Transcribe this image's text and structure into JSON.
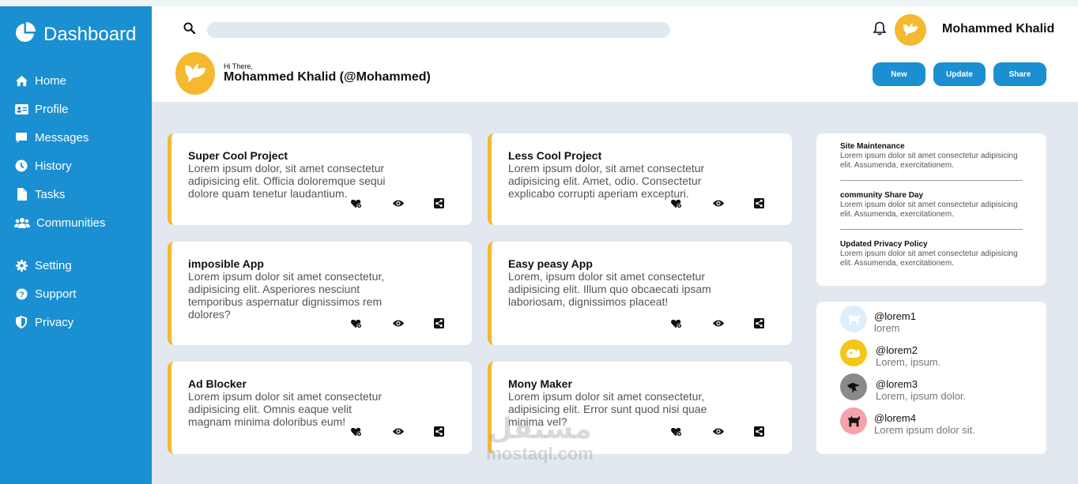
{
  "sidebar": {
    "brand": "Dashboard",
    "items": [
      {
        "label": "Home",
        "icon": "home-icon"
      },
      {
        "label": "Profile",
        "icon": "id-card-icon"
      },
      {
        "label": "Messages",
        "icon": "message-icon"
      },
      {
        "label": "History",
        "icon": "clock-icon"
      },
      {
        "label": "Tasks",
        "icon": "file-icon"
      },
      {
        "label": "Communities",
        "icon": "users-icon"
      },
      {
        "label": "Setting",
        "icon": "gear-icon"
      },
      {
        "label": "Support",
        "icon": "question-icon"
      },
      {
        "label": "Privacy",
        "icon": "shield-icon"
      }
    ]
  },
  "header": {
    "search": {
      "placeholder": "",
      "value": ""
    },
    "user_name": "Mohammed Khalid",
    "greeting_small": "Hi There,",
    "greeting_name": "Mohammed Khalid (@Mohammed)",
    "buttons": {
      "new": "New",
      "update": "Update",
      "share": "Share"
    }
  },
  "projects": [
    {
      "title": "Super Cool Project",
      "description": "Lorem ipsum dolor, sit amet consectetur adipisicing elit. Officia doloremque sequi dolore quam tenetur laudantium."
    },
    {
      "title": "Less Cool Project",
      "description": "Lorem ipsum dolor, sit amet consectetur adipisicing elit. Amet, odio. Consectetur explicabo corrupti aperiam excepturi."
    },
    {
      "title": "imposible App",
      "description": "Lorem ipsum dolor sit amet consectetur, adipisicing elit. Asperiores nesciunt temporibus aspernatur dignissimos rem dolores?"
    },
    {
      "title": "Easy peasy App",
      "description": "Lorem, ipsum dolor sit amet consectetur adipisicing elit. Illum quo obcaecati ipsam laboriosam, dignissimos placeat!"
    },
    {
      "title": "Ad Blocker",
      "description": "Lorem ipsum dolor sit amet consectetur adipisicing elit. Omnis eaque velit magnam minima doloribus eum!"
    },
    {
      "title": "Mony Maker",
      "description": "Lorem ipsum dolor sit amet consectetur, adipisicing elit. Error sunt quod nisi quae minima vel?"
    }
  ],
  "announcements": [
    {
      "title": "Site Maintenance",
      "body": "Lorem ipsum dolor sit amet consectetur adipisicing elit. Assumenda, exercitationem."
    },
    {
      "title": "community Share Day",
      "body": "Lorem ipsum dolor sit amet consectetur adipisicing elit. Assumenda, exercitationem."
    },
    {
      "title": "Updated Privacy Policy",
      "body": "Lorem ipsum dolor sit amet consectetur adipisicing elit. Assumenda, exercitationem."
    }
  ],
  "trending_users": [
    {
      "handle": "@lorem1",
      "bio": "lorem",
      "avatar_color": "#dbeefb"
    },
    {
      "handle": "@lorem2",
      "bio": "Lorem, ipsum.",
      "avatar_color": "#f5c518"
    },
    {
      "handle": "@lorem3",
      "bio": "Lorem, ipsum dolor.",
      "avatar_color": "#8a8a8a"
    },
    {
      "handle": "@lorem4",
      "bio": "Lorem ipsum dolor sit.",
      "avatar_color": "#f4a3ad"
    }
  ],
  "watermark": {
    "arabic": "مستقل",
    "latin": "mostaql.com"
  },
  "colors": {
    "sidebar": "#1a8fd1",
    "accent": "#f5b82e",
    "background": "#e2e8f0",
    "button": "#1a8fd1"
  }
}
